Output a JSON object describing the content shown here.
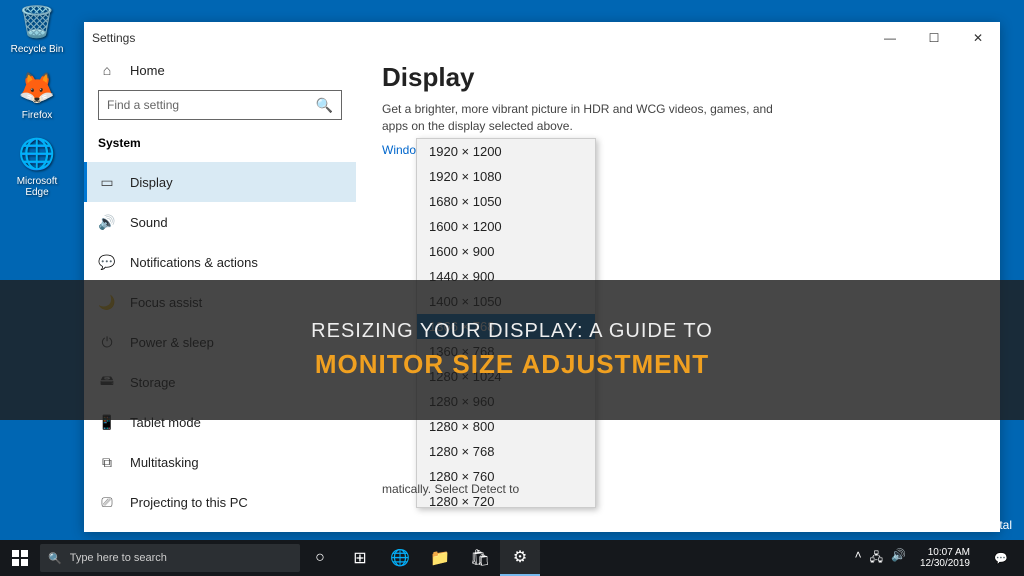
{
  "desktop": {
    "recycle": "Recycle Bin",
    "firefox": "Firefox",
    "edge": "Microsoft Edge"
  },
  "window": {
    "title": "Settings",
    "home": "Home",
    "search_placeholder": "Find a setting",
    "category": "System",
    "nav": [
      {
        "icon": "▭",
        "label": "Display"
      },
      {
        "icon": "🔊",
        "label": "Sound"
      },
      {
        "icon": "💬",
        "label": "Notifications & actions"
      },
      {
        "icon": "🌙",
        "label": "Focus assist"
      },
      {
        "icon": "⏻",
        "label": "Power & sleep"
      },
      {
        "icon": "🖴",
        "label": "Storage"
      },
      {
        "icon": "📱",
        "label": "Tablet mode"
      },
      {
        "icon": "⧉",
        "label": "Multitasking"
      },
      {
        "icon": "⎚",
        "label": "Projecting to this PC"
      }
    ]
  },
  "main": {
    "heading": "Display",
    "desc": "Get a brighter, more vibrant picture in HDR and WCG videos, games, and apps on the display selected above.",
    "link": "Windows HD Color settings",
    "detect": "matically. Select Detect to"
  },
  "resolutions": [
    "1920 × 1200",
    "1920 × 1080",
    "1680 × 1050",
    "1600 × 1200",
    "1600 × 900",
    "1440 × 900",
    "1400 × 1050",
    "1366 × 768",
    "1360 × 768",
    "1280 × 1024",
    "1280 × 960",
    "1280 × 800",
    "1280 × 768",
    "1280 × 760",
    "1280 × 720"
  ],
  "selected_resolution_index": 7,
  "overlay": {
    "line1": "RESIZING YOUR DISPLAY: A GUIDE TO",
    "line2": "MONITOR SIZE ADJUSTMENT"
  },
  "watermark": "Shun Digital",
  "taskbar": {
    "search_placeholder": "Type here to search",
    "time": "10:07 AM",
    "date": "12/30/2019"
  }
}
